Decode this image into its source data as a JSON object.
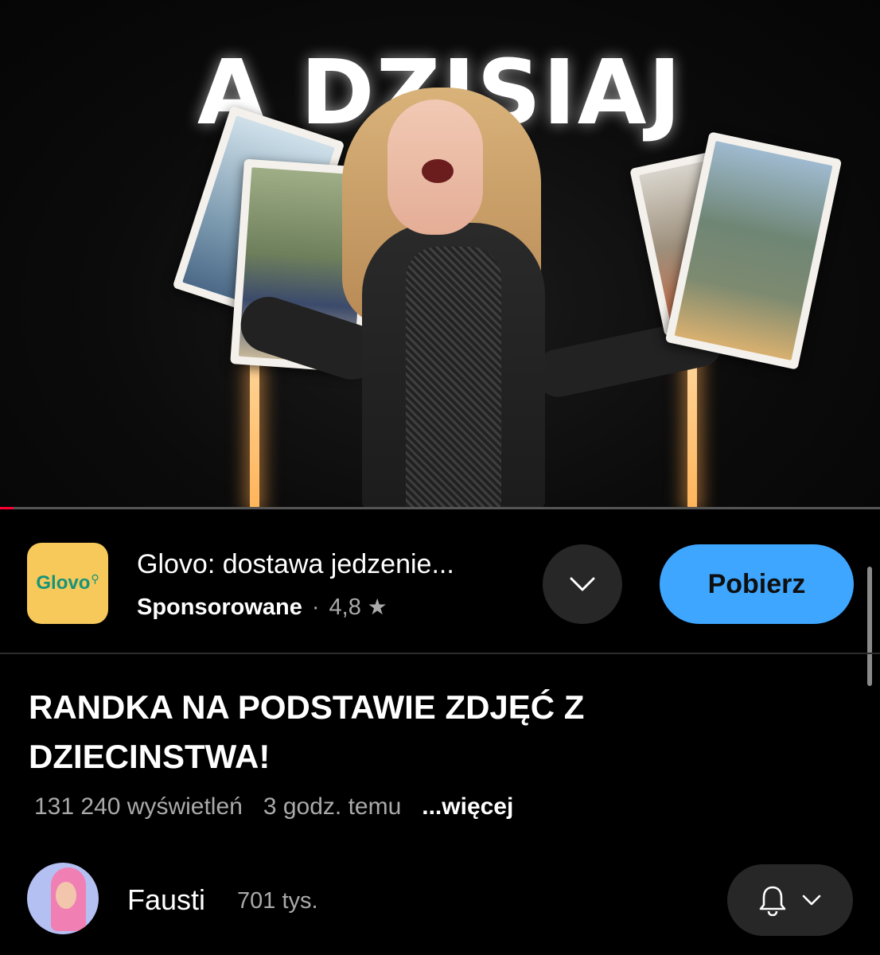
{
  "video": {
    "overlay_text": "A DZISIAJ",
    "progress_fraction": 0.015
  },
  "ad": {
    "logo_text": "Glovo",
    "title": "Glovo: dostawa jedzenie...",
    "sponsored_label": "Sponsorowane",
    "separator": "·",
    "rating": "4,8",
    "cta_label": "Pobierz",
    "expand_icon": "chevron-down-icon",
    "brand_color": "#f7c85a",
    "cta_color": "#3ea6ff"
  },
  "main": {
    "title": "RANDKA NA PODSTAWIE ZDJĘĆ Z DZIECINSTWA!",
    "views": "131 240 wyświetleń",
    "age": "3 godz. temu",
    "more_label": "...więcej"
  },
  "channel": {
    "name": "Fausti",
    "subscribers": "701 tys.",
    "bell_icon": "bell-icon",
    "chevron_icon": "chevron-down-icon"
  }
}
